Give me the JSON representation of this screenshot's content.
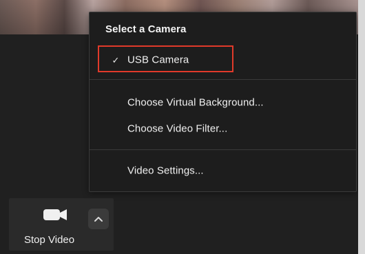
{
  "menu": {
    "heading": "Select a Camera",
    "items": [
      {
        "label": "USB Camera",
        "checked": true
      },
      {
        "label": "Choose Virtual Background..."
      },
      {
        "label": "Choose Video Filter..."
      },
      {
        "label": "Video Settings..."
      }
    ],
    "check_mark": "✓",
    "highlight_color": "#e23a2a"
  },
  "controls": {
    "stop_video_label": "Stop Video",
    "video_icon": "video-camera-icon",
    "chevron_icon": "chevron-up-icon"
  },
  "colors": {
    "menu_bg": "#1d1d1d",
    "menu_border": "#3b3b3b",
    "text": "#f0f0f0",
    "control_bg": "#2a2a2a",
    "control_hover": "#3b3b3b"
  }
}
